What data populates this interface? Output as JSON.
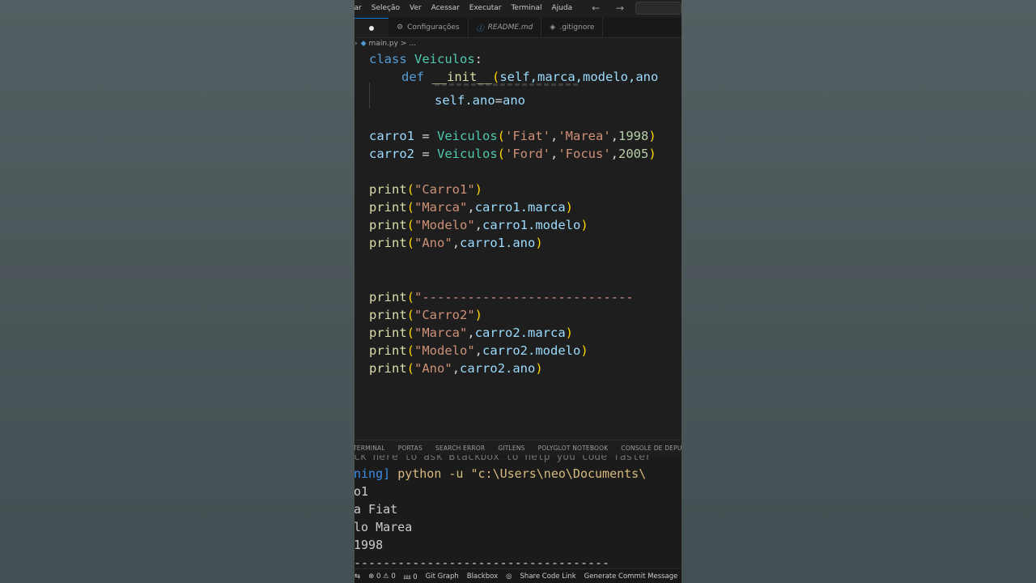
{
  "menu": [
    "tar",
    "Seleção",
    "Ver",
    "Acessar",
    "Executar",
    "Terminal",
    "Ajuda"
  ],
  "nav_arrows": "← →",
  "tabs": [
    {
      "icon": "⚙",
      "label": "Configurações"
    },
    {
      "icon": "ⓘ",
      "label": "README.md"
    },
    {
      "icon": "◈",
      "label": ".gitignore"
    }
  ],
  "breadcrumb": {
    "file": "main.py",
    "sep": ">",
    "rest": "..."
  },
  "code": {
    "class_kw": "class",
    "class_name": "Veiculos",
    "colon": ":",
    "def_kw": "def",
    "init_name": "__init__",
    "init_args": "self,marca,modelo,ano",
    "self_ano": "self.ano",
    "eq": "=",
    "ano_val": "ano",
    "carro1_var": "carro1",
    "carro2_var": "carro2",
    "assign": " = ",
    "cls_call": "Veiculos",
    "c1_marca": "'Fiat'",
    "c1_modelo": "'Marea'",
    "c1_ano": "1998",
    "c2_marca": "'Ford'",
    "c2_modelo": "'Focus'",
    "c2_ano": "2005",
    "print": "print",
    "s_carro1": "\"Carro1\"",
    "s_carro2": "\"Carro2\"",
    "s_marca": "\"Marca\"",
    "s_modelo": "\"Modelo\"",
    "s_ano": "\"Ano\"",
    "s_dashes": "\"----------------------------",
    "a_c1_marca": "carro1.marca",
    "a_c1_modelo": "carro1.modelo",
    "a_c1_ano": "carro1.ano",
    "a_c2_marca": "carro2.marca",
    "a_c2_modelo": "carro2.modelo",
    "a_c2_ano": "carro2.ano"
  },
  "panel_tabs": [
    "TERMINAL",
    "PORTAS",
    "SEARCH ERROR",
    "GITLENS",
    "POLYGLOT NOTEBOOK",
    "CONSOLE DE DEPURAÇÃO"
  ],
  "terminal": {
    "hint": "ck here to ask Blackbox to help you code faster",
    "running": "ning]",
    "command": "python -u \"c:\\Users\\neo\\Documents\\",
    "out1": "o1",
    "out2": "a Fiat",
    "out3": "lo Marea",
    "out4": "1998",
    "out5": "-----------------------------------"
  },
  "status": {
    "errors": "⊗ 0 ⚠ 0",
    "ports": "⅏ 0",
    "git_graph": "Git Graph",
    "blackbox": "Blackbox",
    "share": "Share Code Link",
    "commit": "Generate Commit Message"
  },
  "colors": {
    "editor_bg": "#1e1e1e",
    "keyword": "#569cd6",
    "class": "#4ec9b0",
    "function": "#dcdcaa",
    "variable": "#9cdcfe",
    "string": "#ce9178",
    "number": "#b5cea8",
    "bracket": "#ffd700"
  }
}
